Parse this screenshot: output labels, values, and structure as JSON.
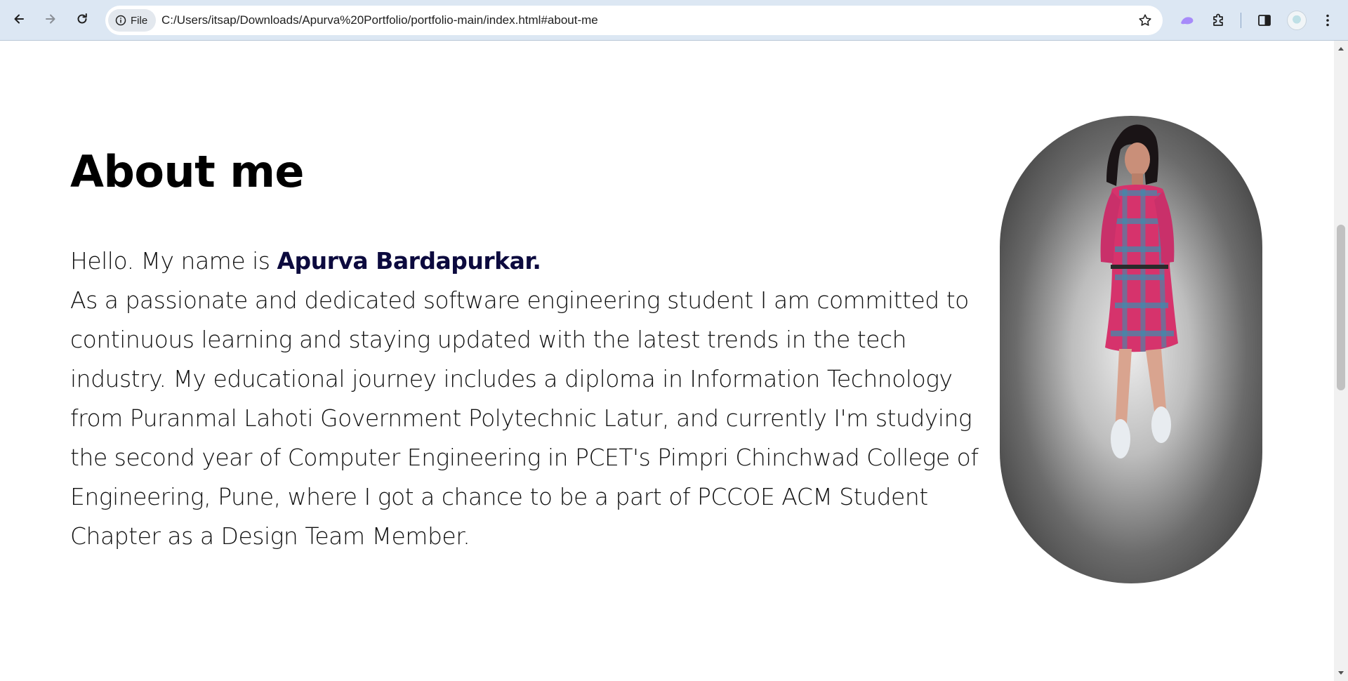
{
  "browser": {
    "address_chip": "File",
    "url": "C:/Users/itsap/Downloads/Apurva%20Portfolio/portfolio-main/index.html#about-me",
    "icons": [
      "back-arrow-icon",
      "forward-arrow-icon",
      "reload-icon",
      "info-icon",
      "bookmark-star-icon",
      "extension-app-icon",
      "puzzle-extensions-icon",
      "side-panel-icon",
      "profile-avatar-icon",
      "kebab-menu-icon"
    ],
    "colors": {
      "toolbar": "#dce7f3",
      "omnibox": "#ffffff"
    }
  },
  "page": {
    "section_title": "About me",
    "intro": "Hello. My name is ",
    "name": "Apurva Bardapurkar.",
    "bio": "As a passionate and dedicated software engineering student I am committed to continuous learning and staying updated with the latest trends in the tech industry. My educational journey includes a diploma in Information Technology from Puranmal Lahoti Government Polytechnic Latur, and currently I'm studying the second year of Computer Engineering in PCET's Pimpri Chinchwad College of Engineering, Pune, where I got a chance to be a part of PCCOE ACM Student Chapter as a Design Team Member.",
    "colors": {
      "name_accent": "#0c0a3e",
      "text": "#111111"
    }
  }
}
